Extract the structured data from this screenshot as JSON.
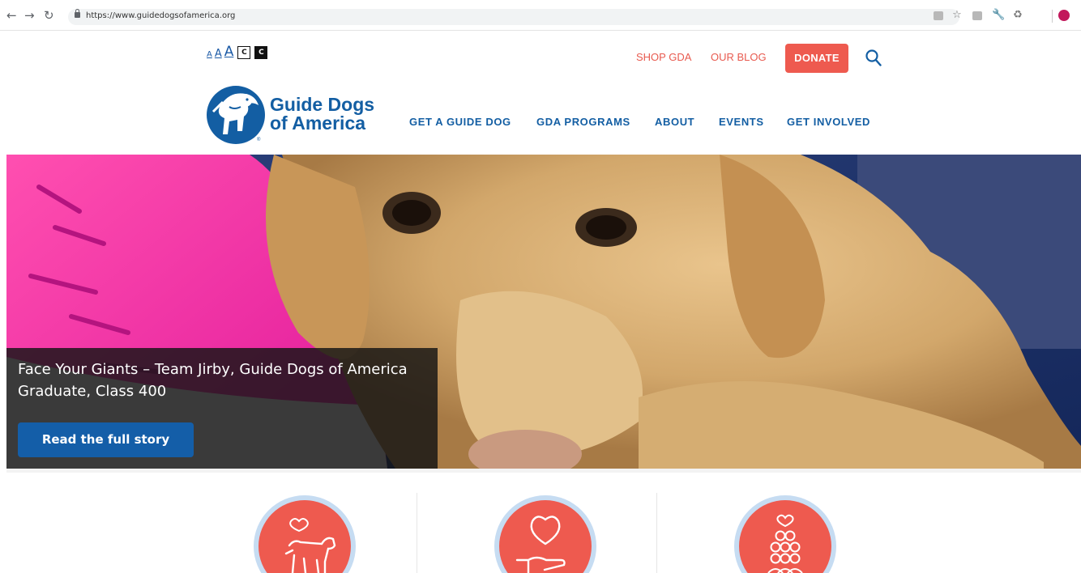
{
  "browser": {
    "url": "https://www.guidedogsofamerica.org",
    "back_icon": "back-arrow-icon",
    "forward_icon": "forward-arrow-icon",
    "reload_icon": "reload-icon"
  },
  "accessibility": {
    "text_size_small": "A",
    "text_size_medium": "A",
    "text_size_large": "A",
    "contrast_light": "C",
    "contrast_dark": "C"
  },
  "utility_nav": {
    "shop": "SHOP GDA",
    "blog": "OUR BLOG",
    "donate": "DONATE"
  },
  "logo": {
    "line1": "Guide Dogs",
    "line2": "of America",
    "registered": "®"
  },
  "main_nav": [
    "GET A GUIDE DOG",
    "GDA PROGRAMS",
    "ABOUT",
    "EVENTS",
    "GET INVOLVED"
  ],
  "hero": {
    "caption": "Face Your Giants – Team Jirby, Guide Dogs of America Graduate, Class 400",
    "button": "Read the full story"
  },
  "programs": [
    {
      "icon": "dog-with-heart-icon"
    },
    {
      "icon": "heart-in-hand-icon"
    },
    {
      "icon": "people-pyramid-icon"
    }
  ],
  "colors": {
    "brand_blue": "#135ea3",
    "accent_coral": "#ee5a4f",
    "circle_ring": "#c6dcf2"
  }
}
